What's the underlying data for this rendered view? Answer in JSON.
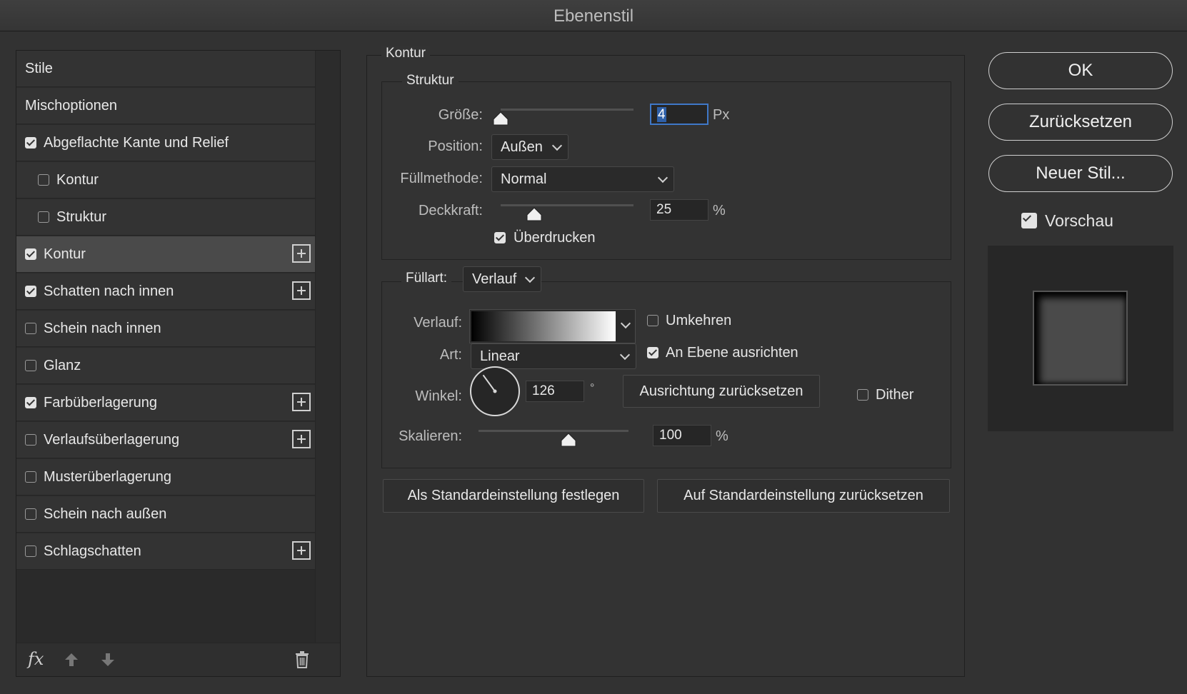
{
  "window": {
    "title": "Ebenenstil"
  },
  "style_list": {
    "items": [
      {
        "label": "Stile",
        "checkbox": false,
        "checked": false,
        "indent": false,
        "selected": false,
        "plus": false
      },
      {
        "label": "Mischoptionen",
        "checkbox": false,
        "checked": false,
        "indent": false,
        "selected": false,
        "plus": false
      },
      {
        "label": "Abgeflachte Kante und Relief",
        "checkbox": true,
        "checked": true,
        "indent": false,
        "selected": false,
        "plus": false
      },
      {
        "label": "Kontur",
        "checkbox": true,
        "checked": false,
        "indent": true,
        "selected": false,
        "plus": false
      },
      {
        "label": "Struktur",
        "checkbox": true,
        "checked": false,
        "indent": true,
        "selected": false,
        "plus": false
      },
      {
        "label": "Kontur",
        "checkbox": true,
        "checked": true,
        "indent": false,
        "selected": true,
        "plus": true
      },
      {
        "label": "Schatten nach innen",
        "checkbox": true,
        "checked": true,
        "indent": false,
        "selected": false,
        "plus": true
      },
      {
        "label": "Schein nach innen",
        "checkbox": true,
        "checked": false,
        "indent": false,
        "selected": false,
        "plus": false
      },
      {
        "label": "Glanz",
        "checkbox": true,
        "checked": false,
        "indent": false,
        "selected": false,
        "plus": false
      },
      {
        "label": "Farbüberlagerung",
        "checkbox": true,
        "checked": true,
        "indent": false,
        "selected": false,
        "plus": true
      },
      {
        "label": "Verlaufsüberlagerung",
        "checkbox": true,
        "checked": false,
        "indent": false,
        "selected": false,
        "plus": true
      },
      {
        "label": "Musterüberlagerung",
        "checkbox": true,
        "checked": false,
        "indent": false,
        "selected": false,
        "plus": false
      },
      {
        "label": "Schein nach außen",
        "checkbox": true,
        "checked": false,
        "indent": false,
        "selected": false,
        "plus": false
      },
      {
        "label": "Schlagschatten",
        "checkbox": true,
        "checked": false,
        "indent": false,
        "selected": false,
        "plus": true
      }
    ],
    "footer": {
      "fx_label": "fx",
      "icons": [
        "fx-icon",
        "arrow-up-icon",
        "arrow-down-icon",
        "trash-icon"
      ]
    }
  },
  "kontur": {
    "section_title": "Kontur",
    "struktur": {
      "title": "Struktur",
      "size_label": "Größe:",
      "size_value": "4",
      "size_unit": "Px",
      "size_slider_fraction": 0.0,
      "position_label": "Position:",
      "position_value": "Außen",
      "blend_label": "Füllmethode:",
      "blend_value": "Normal",
      "opacity_label": "Deckkraft:",
      "opacity_value": "25",
      "opacity_unit": "%",
      "opacity_slider_fraction": 0.25,
      "overprint_label": "Überdrucken",
      "overprint_checked": true
    },
    "fill": {
      "type_label": "Füllart:",
      "type_value": "Verlauf",
      "gradient_label": "Verlauf:",
      "gradient_colors": [
        "#000000",
        "#ffffff"
      ],
      "reverse_label": "Umkehren",
      "reverse_checked": false,
      "style_label": "Art:",
      "style_value": "Linear",
      "align_label": "An Ebene ausrichten",
      "align_checked": true,
      "angle_label": "Winkel:",
      "angle_value": "126",
      "angle_unit": "°",
      "reset_alignment_label": "Ausrichtung zurücksetzen",
      "dither_label": "Dither",
      "dither_checked": false,
      "scale_label": "Skalieren:",
      "scale_value": "100",
      "scale_unit": "%",
      "scale_slider_fraction": 0.6
    },
    "make_default_label": "Als Standardeinstellung festlegen",
    "reset_default_label": "Auf Standardeinstellung zurücksetzen"
  },
  "actions": {
    "ok_label": "OK",
    "reset_label": "Zurücksetzen",
    "new_style_label": "Neuer Stil...",
    "preview_label": "Vorschau",
    "preview_checked": true
  },
  "colors": {
    "background": "#323232",
    "accent": "#3f78c8",
    "selected_row": "#4a4a4a"
  }
}
